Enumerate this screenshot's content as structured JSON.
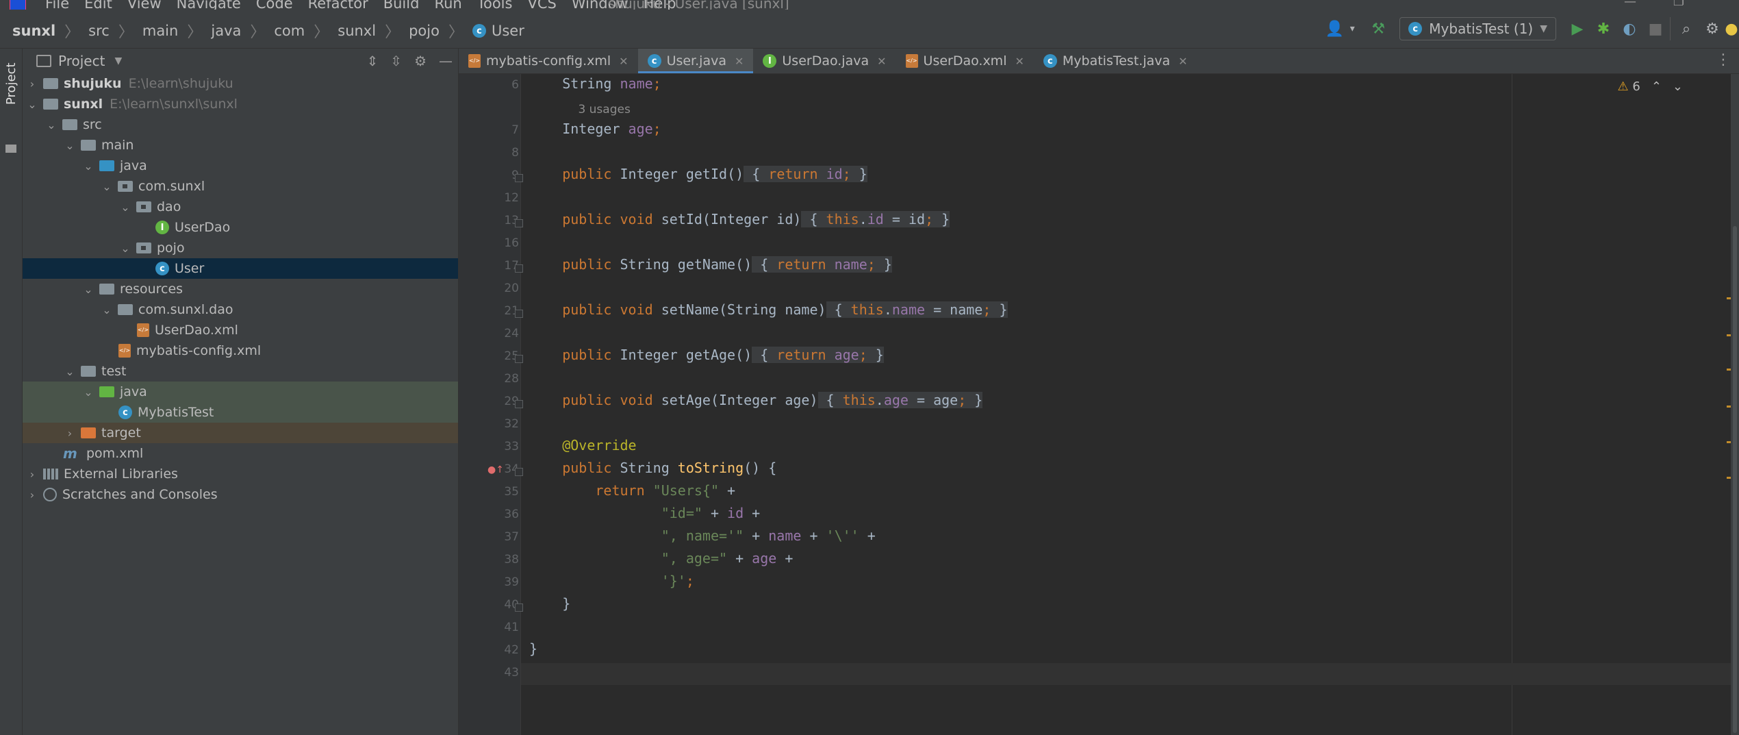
{
  "menu": {
    "items": [
      "File",
      "Edit",
      "View",
      "Navigate",
      "Code",
      "Refactor",
      "Build",
      "Run",
      "Tools",
      "VCS",
      "Window",
      "Help"
    ],
    "window_title": "shujuku - User.java [sunxl]"
  },
  "breadcrumb": {
    "items": [
      "sunxl",
      "src",
      "main",
      "java",
      "com",
      "sunxl",
      "pojo",
      "User"
    ]
  },
  "toolbar": {
    "run_config": "MybatisTest (1)"
  },
  "project_panel": {
    "title": "Project",
    "tree": [
      {
        "label": "shujuku",
        "path": "E:\\learn\\shujuku"
      },
      {
        "label": "sunxl",
        "path": "E:\\learn\\sunxl\\sunxl"
      },
      {
        "label": "src"
      },
      {
        "label": "main"
      },
      {
        "label": "java"
      },
      {
        "label": "com.sunxl"
      },
      {
        "label": "dao"
      },
      {
        "label": "UserDao"
      },
      {
        "label": "pojo"
      },
      {
        "label": "User"
      },
      {
        "label": "resources"
      },
      {
        "label": "com.sunxl.dao"
      },
      {
        "label": "UserDao.xml"
      },
      {
        "label": "mybatis-config.xml"
      },
      {
        "label": "test"
      },
      {
        "label": "java"
      },
      {
        "label": "MybatisTest"
      },
      {
        "label": "target"
      },
      {
        "label": "pom.xml"
      },
      {
        "label": "External Libraries"
      },
      {
        "label": "Scratches and Consoles"
      }
    ]
  },
  "tabs": [
    {
      "label": "mybatis-config.xml"
    },
    {
      "label": "User.java"
    },
    {
      "label": "UserDao.java"
    },
    {
      "label": "UserDao.xml"
    },
    {
      "label": "MybatisTest.java"
    }
  ],
  "editor": {
    "warnings_count": "6",
    "usage_hint": "3 usages",
    "line_numbers": [
      "6",
      "",
      "7",
      "8",
      "9",
      "12",
      "13",
      "16",
      "17",
      "20",
      "21",
      "24",
      "25",
      "28",
      "29",
      "32",
      "33",
      "34",
      "35",
      "36",
      "37",
      "38",
      "39",
      "40",
      "41",
      "42",
      "43"
    ]
  }
}
